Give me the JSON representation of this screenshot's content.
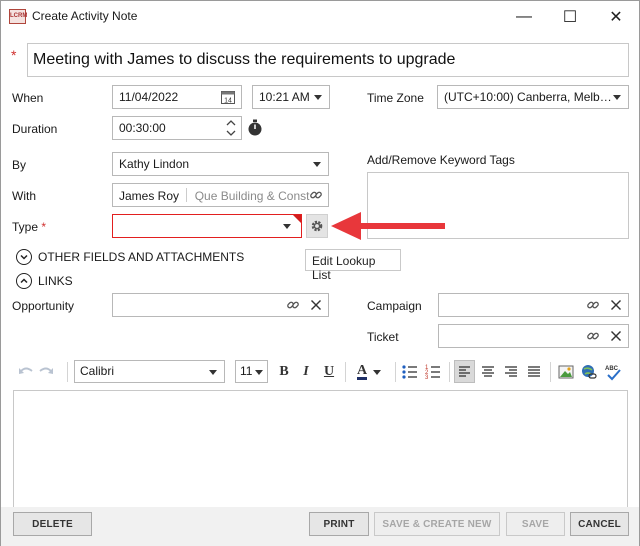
{
  "window": {
    "title": "Create Activity Note",
    "app_icon_text": "LCRM",
    "minimize_glyph": "—",
    "maximize_glyph": "☐",
    "close_glyph": "✕"
  },
  "subject": {
    "required_marker": "*",
    "value": "Meeting with James to discuss the requirements to upgrade"
  },
  "when": {
    "label": "When",
    "date": "11/04/2022",
    "time": "10:21 AM"
  },
  "time_zone": {
    "label": "Time Zone",
    "value": "(UTC+10:00) Canberra, Melb…"
  },
  "duration": {
    "label": "Duration",
    "value": "00:30:00"
  },
  "by": {
    "label": "By",
    "value": "Kathy Lindon"
  },
  "keyword_tags": {
    "label": "Add/Remove Keyword Tags"
  },
  "with": {
    "label": "With",
    "contact": "James Roy",
    "company": "Que Building & Const"
  },
  "type": {
    "label": "Type",
    "required_marker": "*",
    "value": ""
  },
  "tooltip": {
    "text": "Edit Lookup List"
  },
  "sections": {
    "other_fields": "OTHER FIELDS AND ATTACHMENTS",
    "links": "LINKS"
  },
  "links": {
    "opportunity": {
      "label": "Opportunity",
      "value": ""
    },
    "campaign": {
      "label": "Campaign",
      "value": ""
    },
    "ticket": {
      "label": "Ticket",
      "value": ""
    }
  },
  "editor_toolbar": {
    "font": "Calibri",
    "size": "11",
    "bold": "B",
    "italic": "I",
    "underline": "U",
    "font_color": "A"
  },
  "editor": {
    "content": ""
  },
  "buttons": {
    "delete": "DELETE",
    "print": "PRINT",
    "save_create_new": "SAVE & CREATE NEW",
    "save": "SAVE",
    "cancel": "CANCEL"
  },
  "colors": {
    "required": "#d0302f",
    "annotation_arrow": "#e8373b",
    "type_field_border": "#e21f1f"
  }
}
